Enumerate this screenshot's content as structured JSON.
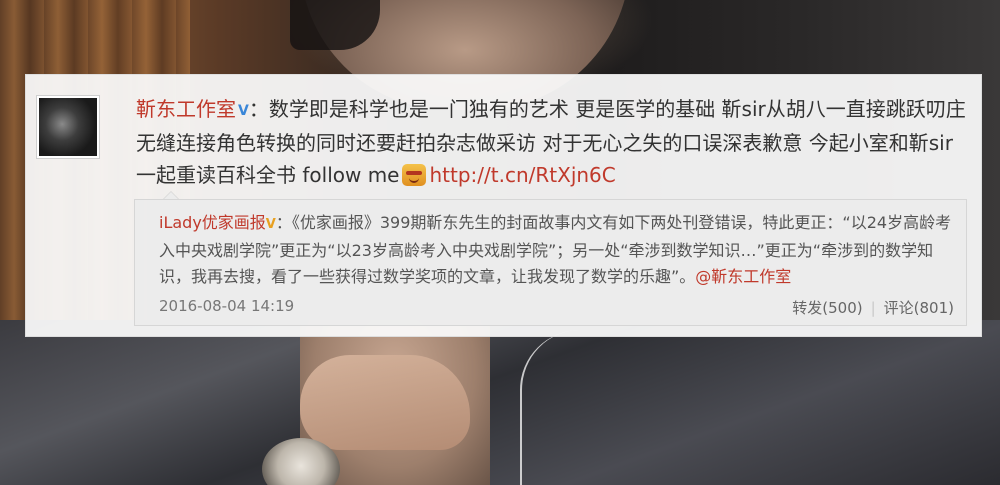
{
  "post": {
    "author": "靳东工作室",
    "verified_icon": "blue-v-verified-icon",
    "text_main": "数学即是科学也是一门独有的艺术 更是医学的基础 靳sir从胡八一直接跳跃叨庄无缝连接角色转换的同时还要赶拍杂志做采访 对于无心之失的口误深表歉意 今起小室和靳sir一起重读百科全书 follow me",
    "emoji_icon": "emoji-face-icon",
    "link": "http://t.cn/RtXjn6C"
  },
  "repost": {
    "author": "iLady优家画报",
    "verified_icon": "gold-v-verified-icon",
    "text": "《优家画报》399期靳东先生的封面故事内文有如下两处刊登错误，特此更正：“以24岁高龄考入中央戏剧学院”更正为“以23岁高龄考入中央戏剧学院”；另一处“牵涉到数学知识…”更正为“牵涉到的数学知识，我再去搜，看了一些获得过数学奖项的文章，让我发现了数学的乐趣”。",
    "mention": "@靳东工作室",
    "timestamp": "2016-08-04 14:19",
    "forward_label": "转发(500)",
    "comment_label": "评论(801)"
  },
  "colors": {
    "author_red": "#c0392b",
    "verify_blue": "#3a86d8",
    "verify_gold": "#e8a020"
  }
}
